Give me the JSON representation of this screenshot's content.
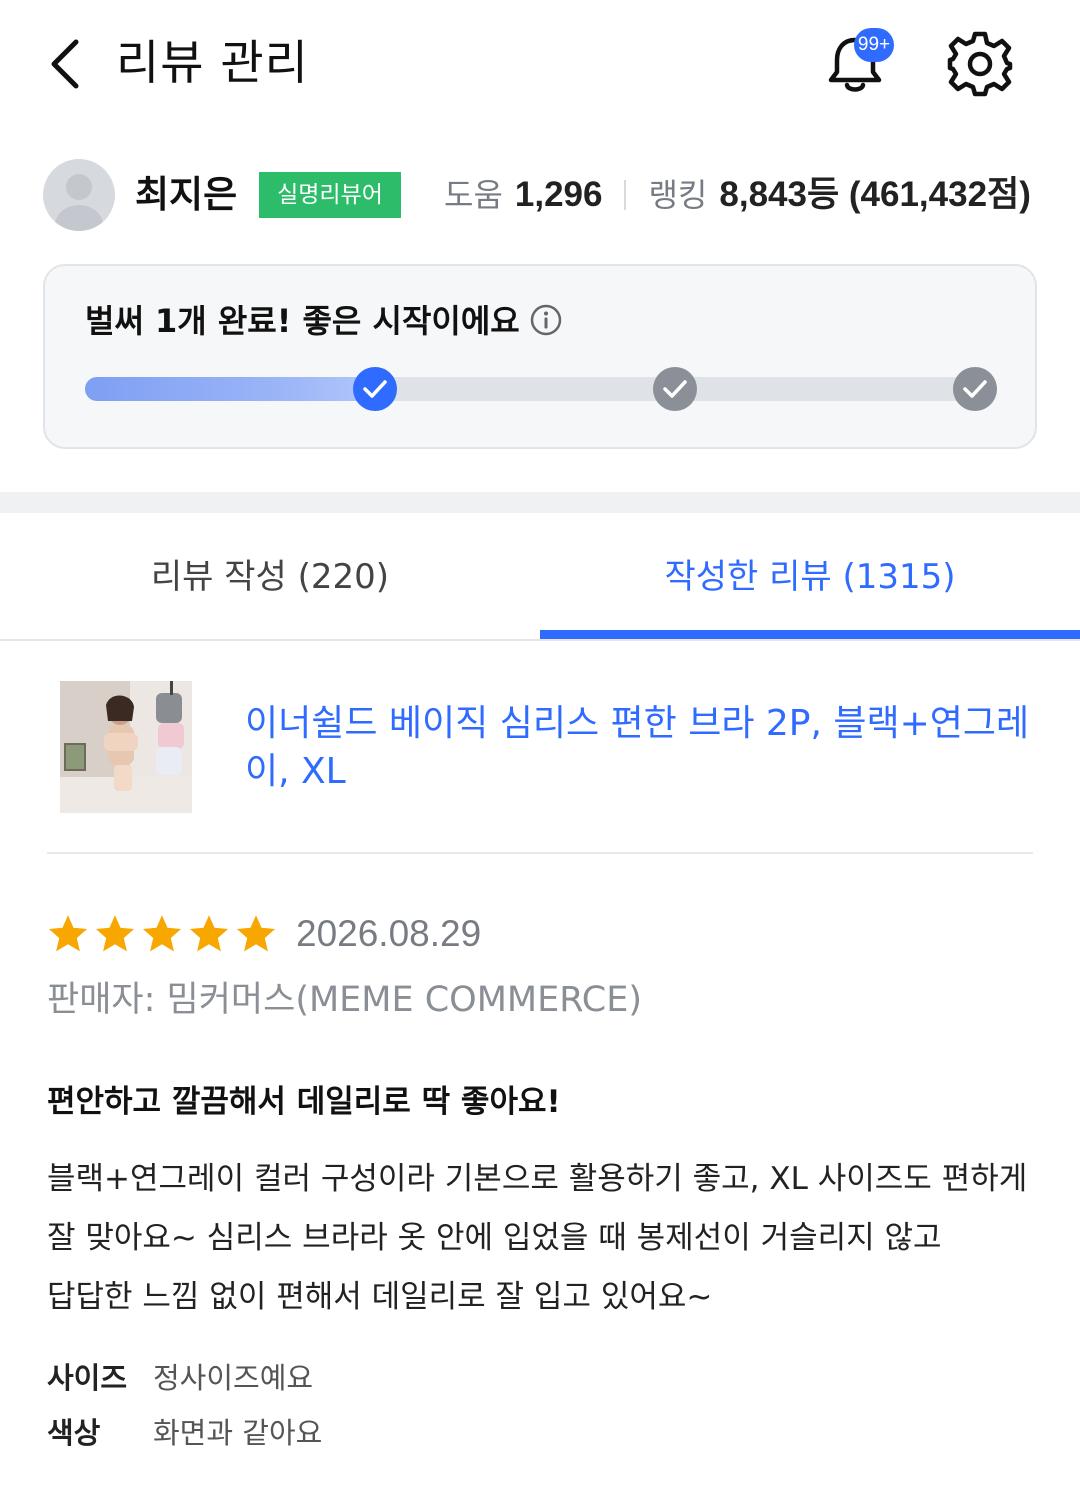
{
  "header": {
    "title": "리뷰 관리",
    "notification_badge": "99+"
  },
  "profile": {
    "name": "최지은",
    "badge": "실명리뷰어",
    "help_label": "도움",
    "help_value": "1,296",
    "ranking_label": "랭킹",
    "ranking_value": "8,843등 (461,432점)"
  },
  "progress": {
    "title": "벌써 1개 완료! 좋은 시작이에요",
    "completed_steps": 1,
    "total_steps": 3
  },
  "tabs": [
    {
      "label": "리뷰 작성 (220)",
      "active": false
    },
    {
      "label": "작성한 리뷰 (1315)",
      "active": true
    }
  ],
  "product": {
    "name": "이너쉴드 베이직 심리스 편한 브라 2P, 블랙+연그레이, XL"
  },
  "review": {
    "rating": 5,
    "date": "2026.08.29",
    "seller": "판매자: 밈커머스(MEME COMMERCE)",
    "headline": "편안하고 깔끔해서 데일리로 딱 좋아요!",
    "body_lines": [
      "블랙+연그레이 컬러 구성이라 기본으로 활용하기 좋고, XL 사이즈도 편하게",
      "잘 맞아요~  심리스 브라라 옷 안에 입었을 때 봉제선이 거슬리지 않고",
      "답답한 느낌 없이 편해서 데일리로 잘 입고 있어요~"
    ],
    "attributes": [
      {
        "key": "사이즈",
        "value": "정사이즈예요"
      },
      {
        "key": "색상",
        "value": "화면과 같아요"
      }
    ]
  },
  "colors": {
    "accent": "#2f6bff",
    "badge_green": "#2dbd6a",
    "star": "#f8a600"
  },
  "icons": {
    "back": "chevron-left-icon",
    "notification": "bell-icon",
    "settings": "gear-icon",
    "info": "info-icon",
    "check": "check-icon",
    "star": "star-icon"
  }
}
